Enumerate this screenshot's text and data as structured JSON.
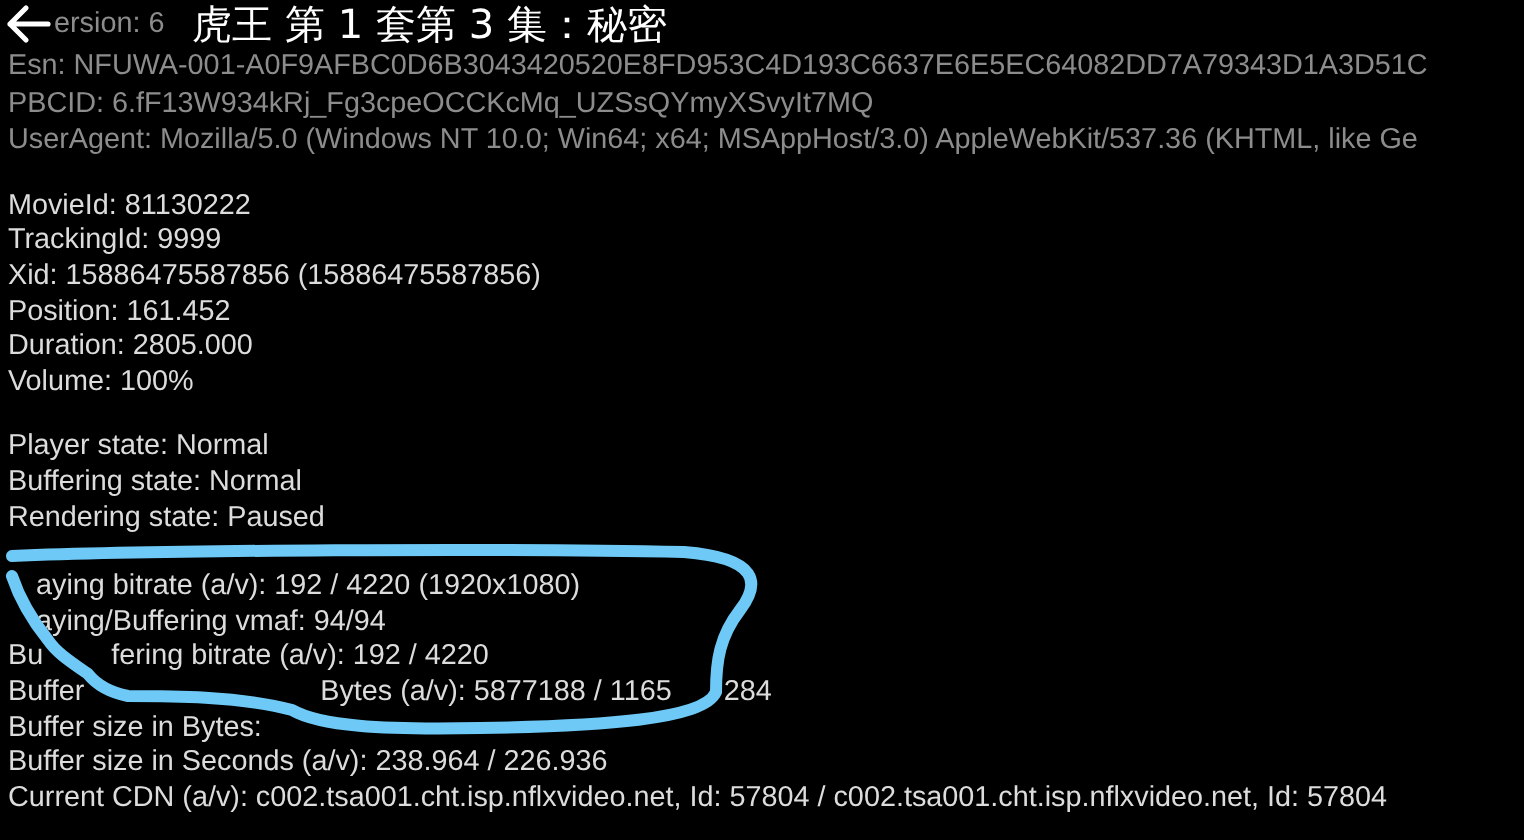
{
  "header": {
    "title": "虎王 第 1 套第 3 集：秘密",
    "version_fragment": "ersion: 6"
  },
  "client_info": [
    "Esn: NFUWA-001-A0F9AFBC0D6B3043420520E8FD953C4D193C6637E6E5EC64082DD7A79343D1A3D51C",
    "PBCID: 6.fF13W934kRj_Fg3cpeOCCKcMq_UZSsQYmyXSvyIt7MQ",
    "UserAgent: Mozilla/5.0 (Windows NT 10.0; Win64; x64; MSAppHost/3.0) AppleWebKit/537.36 (KHTML, like Ge"
  ],
  "playback_info": [
    "MovieId: 81130222",
    "TrackingId: 9999",
    "Xid: 15886475587856 (15886475587856)",
    "Position: 161.452",
    "Duration: 2805.000",
    "Volume: 100%"
  ],
  "states": [
    "Player state: Normal",
    "Buffering state: Normal",
    "Rendering state: Paused"
  ],
  "stream_lines": [
    {
      "segments": [
        "aying bitrate (a/v): 192 / 4220 (1920x1080)"
      ]
    },
    {
      "segments": [
        "aying/Buffering vmaf: 94/94"
      ]
    },
    {
      "segments": [
        "Bu",
        "fering bitrate (a/v): 192 / 4220"
      ]
    },
    {
      "segments": [
        "Buffer",
        "Bytes (a/v): 5877188 / 1165",
        "284"
      ]
    },
    {
      "segments": [
        "Buffer size in Bytes:"
      ]
    },
    {
      "segments": [
        "Buffer size in Seconds (a/v): 238.964 / 226.936"
      ]
    },
    {
      "segments": [
        "Current CDN (a/v): c002.tsa001.cht.isp.nflxvideo.net, Id: 57804 / c002.tsa001.cht.isp.nflxvideo.net, Id: 57804"
      ]
    }
  ]
}
